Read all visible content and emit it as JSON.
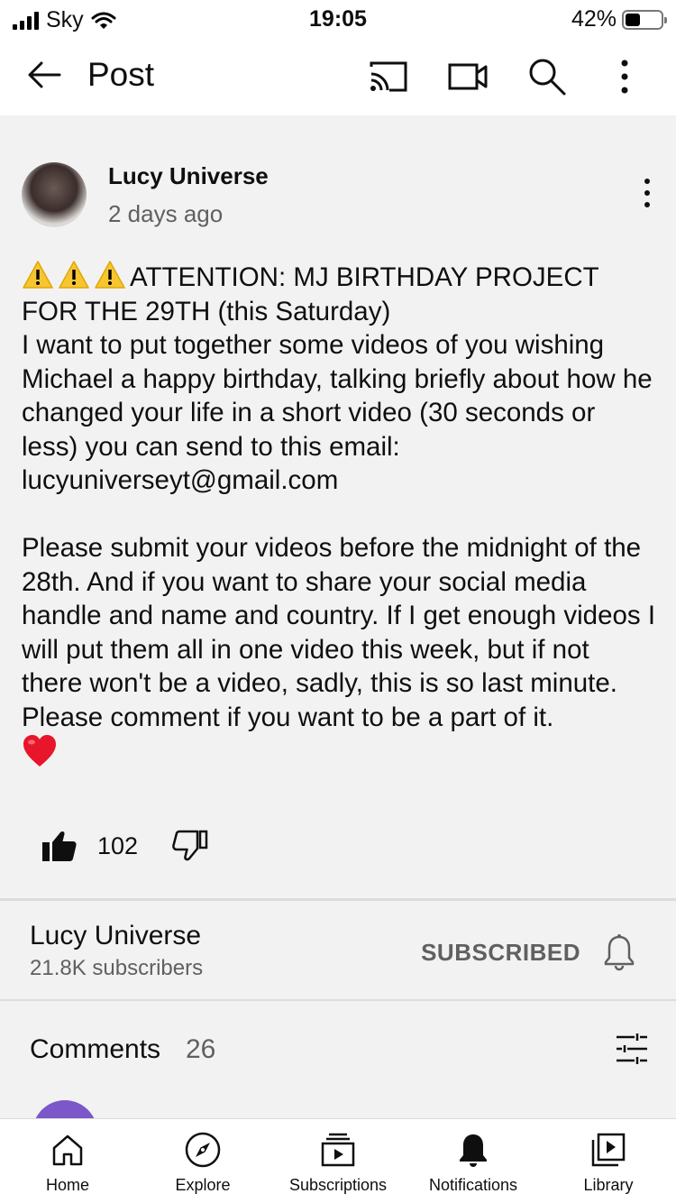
{
  "status_bar": {
    "carrier": "Sky",
    "time": "19:05",
    "battery_percent": "42%",
    "battery_level": 0.42
  },
  "app_bar": {
    "title": "Post",
    "icons": [
      "back-arrow-icon",
      "cast-icon",
      "camera-icon",
      "search-icon",
      "more-vert-icon"
    ]
  },
  "post": {
    "author": "Lucy Universe",
    "time_ago": "2 days ago",
    "text_line1": "ATTENTION: MJ BIRTHDAY PROJECT FOR THE 29TH (this Saturday)",
    "text_body": "I want to put together some videos of you wishing Michael a happy birthday, talking briefly about how he changed your life in a short video (30 seconds or less) you can send to this email: lucyuniverseyt@gmail.com\n\nPlease submit your videos before the midnight of the 28th. And if you want to share your social media handle and name and country. If I get enough videos I will put them all in one video this week, but if not there won't be a video, sadly, this is so last minute.\nPlease comment if you want to be a part of it.",
    "likes": "102"
  },
  "channel": {
    "name": "Lucy Universe",
    "subscribers": "21.8K subscribers",
    "subscribed_label": "SUBSCRIBED"
  },
  "comments": {
    "label": "Comments",
    "count": "26"
  },
  "bottom_nav": {
    "items": [
      {
        "label": "Home",
        "icon": "home-icon"
      },
      {
        "label": "Explore",
        "icon": "compass-icon"
      },
      {
        "label": "Subscriptions",
        "icon": "subscriptions-icon"
      },
      {
        "label": "Notifications",
        "icon": "bell-icon"
      },
      {
        "label": "Library",
        "icon": "library-icon"
      }
    ]
  },
  "colors": {
    "background": "#f2f2f2",
    "secondary_text": "#606060",
    "comment_avatar": "#7b57c9",
    "warning_yellow": "#f7c531",
    "heart_red": "#e8162b"
  }
}
